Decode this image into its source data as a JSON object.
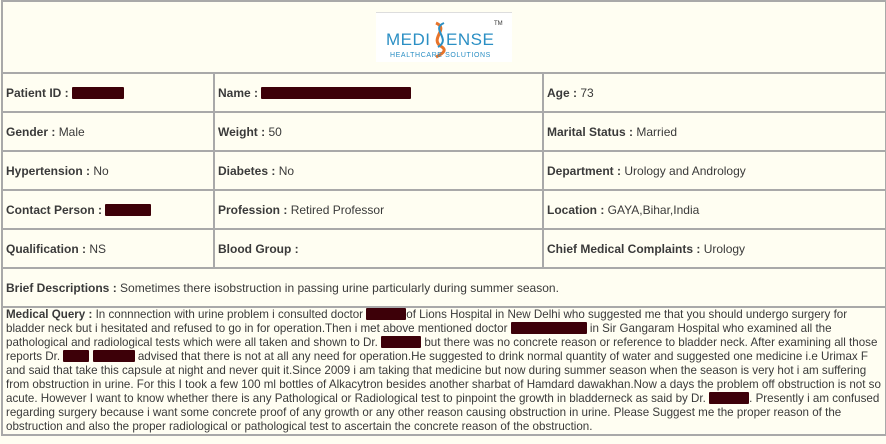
{
  "logo": {
    "brand": "MEDISENSE",
    "tagline": "HEALTHCARE SOLUTIONS",
    "tm": "TM"
  },
  "fields": {
    "patient_id": {
      "label": "Patient ID :",
      "value": ""
    },
    "name": {
      "label": "Name :",
      "value": ""
    },
    "age": {
      "label": "Age :",
      "value": "73"
    },
    "gender": {
      "label": "Gender :",
      "value": "Male"
    },
    "weight": {
      "label": "Weight :",
      "value": "50"
    },
    "marital_status": {
      "label": "Marital Status :",
      "value": "Married"
    },
    "hypertension": {
      "label": "Hypertension :",
      "value": "No"
    },
    "diabetes": {
      "label": "Diabetes :",
      "value": "No"
    },
    "department": {
      "label": "Department :",
      "value": "Urology and Andrology"
    },
    "contact_person": {
      "label": "Contact Person :",
      "value": ""
    },
    "profession": {
      "label": "Profession :",
      "value": "Retired Professor"
    },
    "location": {
      "label": "Location :",
      "value": "GAYA,Bihar,India"
    },
    "qualification": {
      "label": "Qualification :",
      "value": "NS"
    },
    "blood_group": {
      "label": "Blood Group :",
      "value": ""
    },
    "chief_complaints": {
      "label": "Chief Medical Complaints :",
      "value": "Urology"
    }
  },
  "brief": {
    "label": "Brief Descriptions :",
    "text": "Sometimes there isobstruction in passing urine particularly during summer season."
  },
  "query": {
    "label": "Medical Query :",
    "parts": [
      "In connnection with urine problem i consulted doctor",
      "of Lions Hospital in New Delhi who suggested me that you should undergo surgery for bladder neck but i hesitated and refused to go in for operation.Then i met above mentioned doctor",
      "in Sir Gangaram Hospital who examined all the pathological and radiological tests which were all taken and shown to Dr.",
      "but there was no concrete reason or reference to bladder neck. After examining all those reports Dr.",
      "advised that there is not at all any need for operation.He suggested to drink normal quantity of water and suggested one medicine i.e Urimax F and said that take this capsule at night and never quit it.Since 2009 i am taking that medicine but now during summer season when the season is very hot i am suffering from obstruction in urine. For this I took a few 100 ml bottles of Alkacytron besides another sharbat of Hamdard dawakhan.Now a days the problem off obstruction is not so acute. However I want to know whether there is any Pathological or Radiological test to pinpoint the growth in bladderneck as said by Dr.",
      ". Presently i am confused regarding surgery because i want some concrete proof of any growth or any other reason causing obstruction in urine. Please Suggest me the proper reason of the obstruction and also the proper radiological or pathological test to ascertain the concrete reason of the obstruction."
    ]
  },
  "colors": {
    "background": "#fffef2",
    "border": "#a9a9a9",
    "redaction": "#3d0008",
    "brand_blue": "#2b8fc4",
    "brand_orange": "#e8742a"
  }
}
